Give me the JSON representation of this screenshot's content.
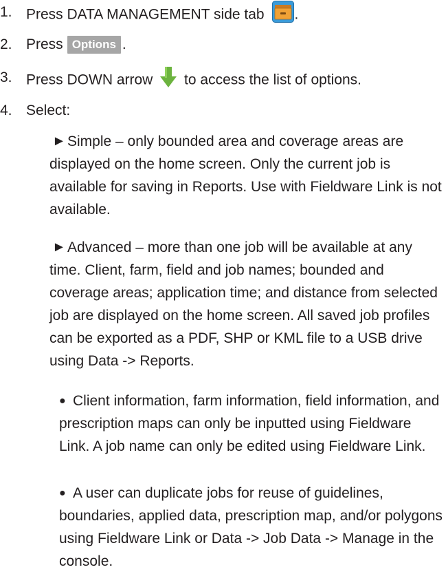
{
  "steps": [
    {
      "num": "1.",
      "text": "Press DATA MANAGEMENT side tab",
      "suffix": ".",
      "icon": "data-management-folder-icon"
    },
    {
      "num": "2.",
      "text": "Press",
      "button": "Options",
      "suffix": "."
    },
    {
      "num": "3.",
      "text": "Press DOWN arrow",
      "suffix": "to access the list of options.",
      "icon": "down-arrow-icon"
    },
    {
      "num": "4.",
      "text": "Select:"
    }
  ],
  "options": [
    {
      "glyph": "►",
      "text": "Simple – only bounded area and coverage areas are displayed on the home screen. Only the current job is available for saving in Reports. Use with Fieldware Link is not available."
    },
    {
      "glyph": "►",
      "text": "Advanced – more than one job will be available at any time. Client, farm, field and job names; bounded and coverage areas; application time; and distance from selected job are displayed on the home screen. All saved job profiles can be exported as a PDF, SHP or KML file to a USB drive using Data -> Reports."
    }
  ],
  "sub_bullets": [
    {
      "glyph": "●",
      "text": "Client information, farm information, field information, and prescription maps can only be inputted using Fieldware Link. A job name can only be edited using Fieldware Link."
    },
    {
      "glyph": "●",
      "text": "A user can duplicate jobs for reuse of guidelines, boundaries, applied data, prescription map, and/or polygons using Fieldware Link or Data -> Job Data -> Manage in the console."
    }
  ],
  "colors": {
    "text": "#231f20",
    "button_bg": "#a6a6a6",
    "arrow_green": "#6cb33f",
    "folder_blue": "#3a9bd9",
    "folder_orange": "#f0a236"
  }
}
